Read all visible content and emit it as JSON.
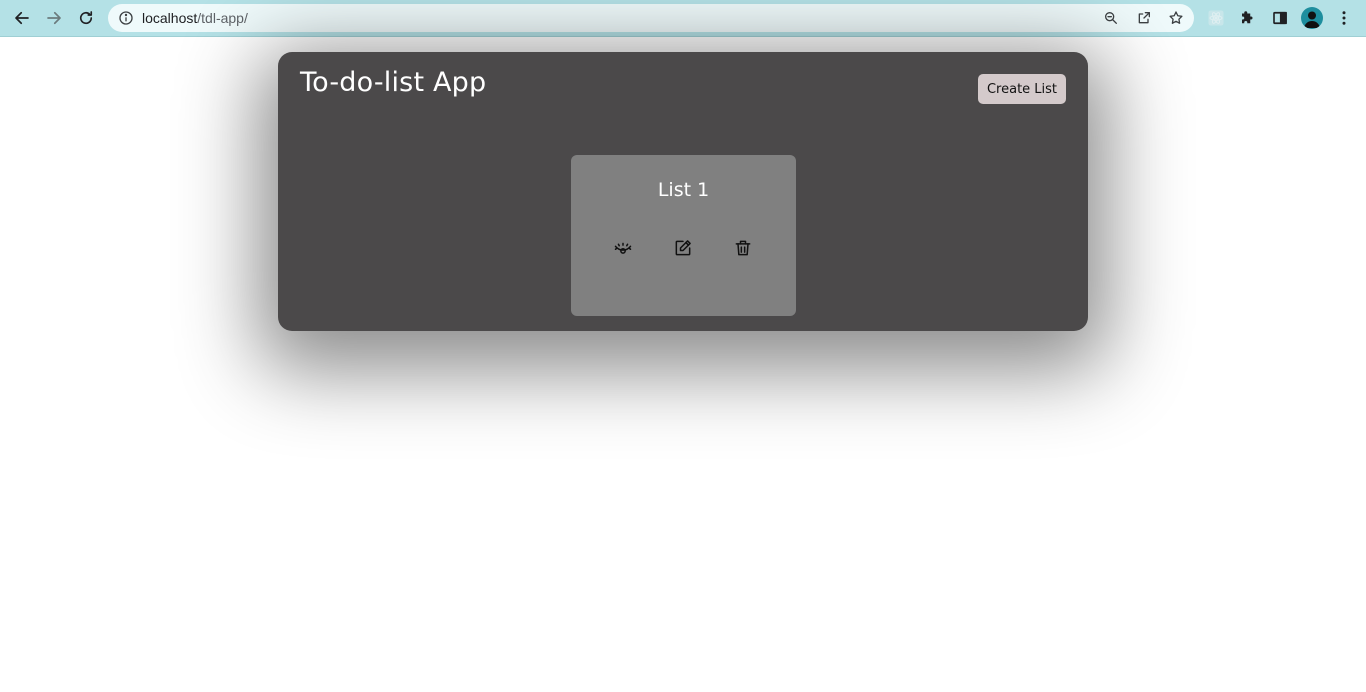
{
  "browser": {
    "url_host": "localhost",
    "url_path": "/tdl-app/",
    "icons": {
      "back": "arrow-left-icon",
      "forward": "arrow-right-icon",
      "reload": "reload-icon",
      "site_info": "info-icon",
      "zoom": "zoom-icon",
      "share": "share-icon",
      "bookmark": "star-icon",
      "extension_react": "react-devtools-icon",
      "extensions": "puzzle-icon",
      "side_panel": "side-panel-icon",
      "profile": "avatar-icon",
      "menu": "kebab-menu-icon"
    }
  },
  "app": {
    "title": "To-do-list App",
    "create_button_label": "Create List",
    "lists": [
      {
        "name": "List 1",
        "actions": [
          "view-icon",
          "edit-icon",
          "trash-icon"
        ]
      }
    ],
    "colors": {
      "card_bg": "#4b494a",
      "list_bg": "#808080",
      "button_bg": "#d4cacb",
      "chrome_bg": "#b4e1e6"
    }
  }
}
